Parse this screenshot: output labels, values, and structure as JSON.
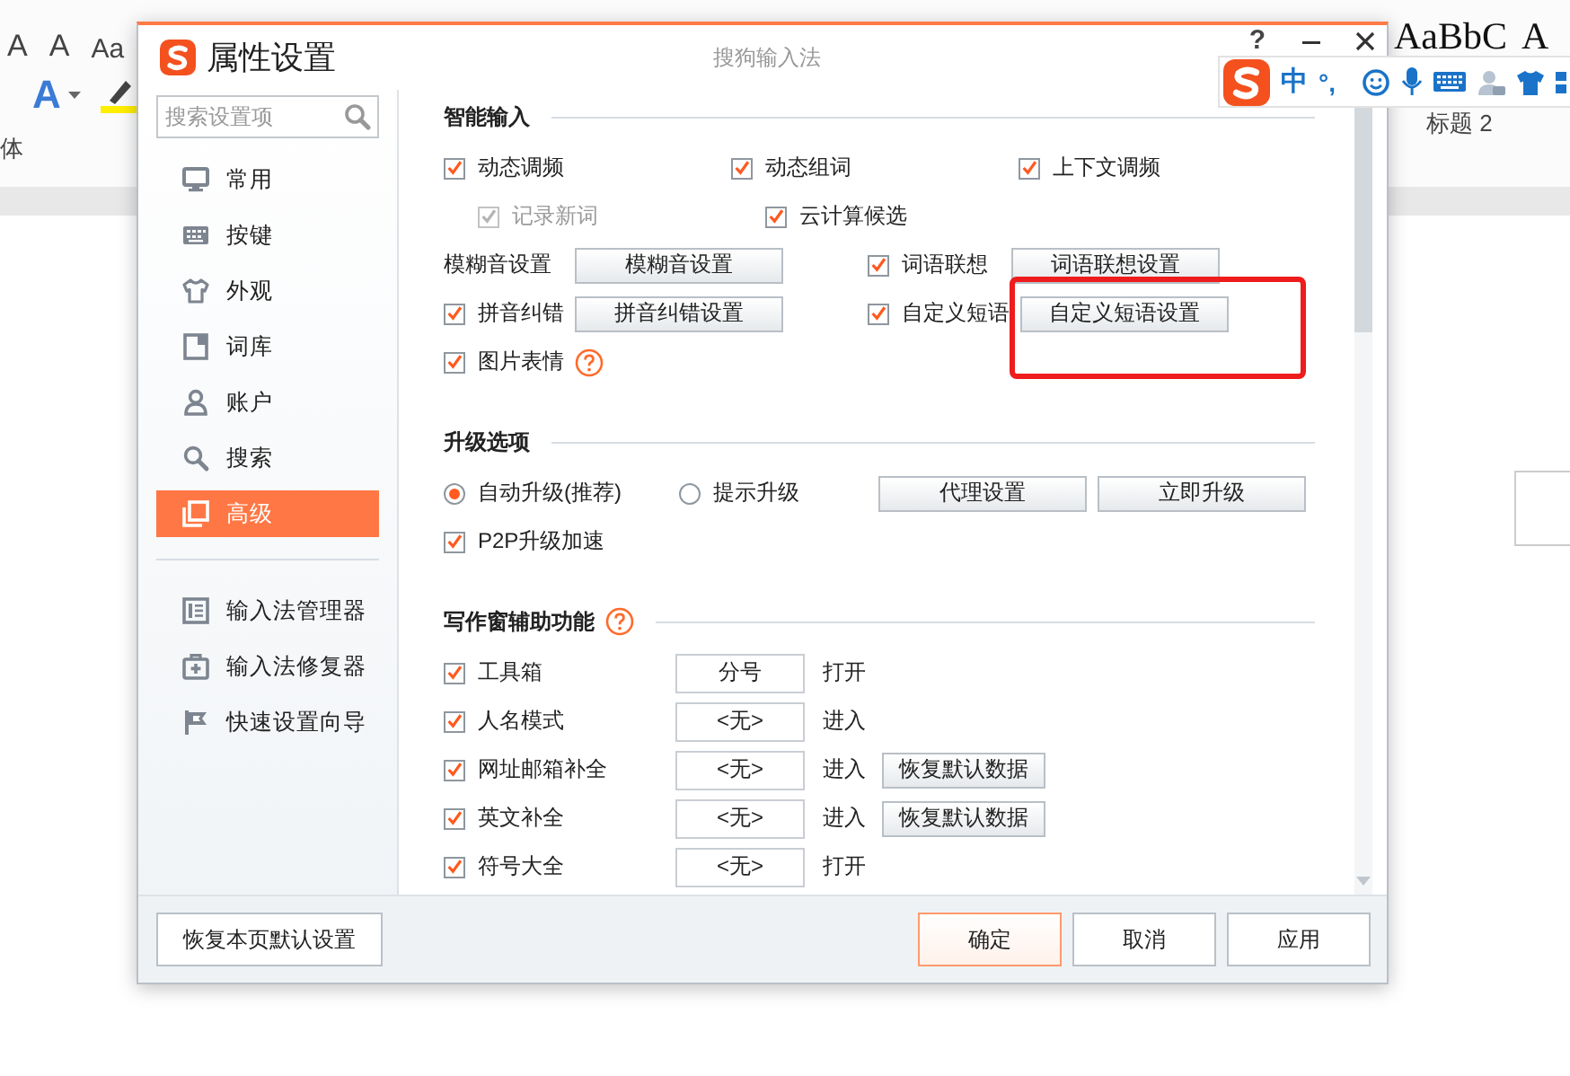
{
  "background_app": {
    "font_buttons": [
      "A",
      "A",
      "Aa"
    ],
    "text_effect": "A",
    "font_label": "体",
    "style_sample": "AaBbC",
    "style_sample_cut": "A",
    "style_name": "标题 2"
  },
  "dialog": {
    "title": "属性设置",
    "app_name": "搜狗输入法",
    "help": "?",
    "sidebar": {
      "search": {
        "placeholder": "搜索设置项"
      },
      "items": [
        {
          "label": "常用",
          "selected": false
        },
        {
          "label": "按键",
          "selected": false
        },
        {
          "label": "外观",
          "selected": false
        },
        {
          "label": "词库",
          "selected": false
        },
        {
          "label": "账户",
          "selected": false
        },
        {
          "label": "搜索",
          "selected": false
        },
        {
          "label": "高级",
          "selected": true
        }
      ],
      "tools": [
        {
          "label": "输入法管理器"
        },
        {
          "label": "输入法修复器"
        },
        {
          "label": "快速设置向导"
        }
      ]
    },
    "sections": [
      {
        "title": "智能输入",
        "help": false,
        "kind": "options",
        "rows": [
          {
            "cells": [
              [
                {
                  "kind": "checkbox",
                  "label": "动态调频",
                  "checked": true,
                  "disabled": false,
                  "children": [
                    {
                      "kind": "checkbox",
                      "label": "记录新词",
                      "checked": true,
                      "disabled": true
                    }
                  ]
                }
              ],
              [
                {
                  "kind": "checkbox",
                  "label": "动态组词",
                  "checked": true,
                  "disabled": false,
                  "children": [
                    {
                      "kind": "checkbox",
                      "label": "云计算候选",
                      "checked": true,
                      "disabled": false
                    }
                  ]
                }
              ],
              [
                {
                  "kind": "checkbox",
                  "label": "上下文调频",
                  "checked": true,
                  "disabled": false
                }
              ]
            ]
          },
          {
            "cells": [
              [
                {
                  "kind": "label",
                  "label": "模糊音设置"
                },
                {
                  "kind": "button",
                  "label": "模糊音设置"
                }
              ],
              [
                {
                  "kind": "checkbox",
                  "label": "词语联想",
                  "checked": true,
                  "disabled": false
                },
                {
                  "kind": "button",
                  "label": "词语联想设置"
                }
              ]
            ]
          },
          {
            "cells": [
              [
                {
                  "kind": "checkbox",
                  "label": "拼音纠错",
                  "checked": true,
                  "disabled": false
                },
                {
                  "kind": "button",
                  "label": "拼音纠错设置"
                }
              ],
              [
                {
                  "kind": "checkbox",
                  "label": "自定义短语",
                  "checked": true,
                  "disabled": false
                },
                {
                  "kind": "button",
                  "label": "自定义短语设置",
                  "highlighted": true
                }
              ]
            ]
          },
          {
            "cells": [
              [
                {
                  "kind": "checkbox",
                  "label": "图片表情",
                  "checked": true,
                  "disabled": false
                },
                {
                  "kind": "help"
                }
              ]
            ]
          }
        ]
      },
      {
        "title": "升级选项",
        "help": false,
        "kind": "options",
        "rows": [
          {
            "cells": [
              [
                {
                  "kind": "radio",
                  "label": "自动升级(推荐)",
                  "selected": true
                },
                {
                  "kind": "radio",
                  "label": "提示升级",
                  "selected": false
                }
              ],
              [
                {
                  "kind": "button",
                  "label": "代理设置"
                },
                {
                  "kind": "button",
                  "label": "立即升级"
                }
              ]
            ]
          },
          {
            "cells": [
              [
                {
                  "kind": "checkbox",
                  "label": "P2P升级加速",
                  "checked": true,
                  "disabled": false
                }
              ]
            ]
          }
        ]
      },
      {
        "title": "写作窗辅助功能",
        "help": true,
        "kind": "shortcuts",
        "rows": [
          {
            "label": "工具箱",
            "checked": true,
            "key": "分号",
            "action": "打开"
          },
          {
            "label": "人名模式",
            "checked": true,
            "key": "<无>",
            "action": "进入"
          },
          {
            "label": "网址邮箱补全",
            "checked": true,
            "key": "<无>",
            "action": "进入",
            "reset": "恢复默认数据"
          },
          {
            "label": "英文补全",
            "checked": true,
            "key": "<无>",
            "action": "进入",
            "reset": "恢复默认数据"
          },
          {
            "label": "符号大全",
            "checked": true,
            "key": "<无>",
            "action": "打开"
          }
        ]
      }
    ],
    "footer": {
      "reset": "恢复本页默认设置",
      "buttons": [
        {
          "label": "确定",
          "kind": "primary"
        },
        {
          "label": "取消",
          "kind": "normal"
        },
        {
          "label": "应用",
          "kind": "normal"
        }
      ]
    }
  },
  "ime_bar": {
    "mode": "中",
    "punct": "°,"
  }
}
